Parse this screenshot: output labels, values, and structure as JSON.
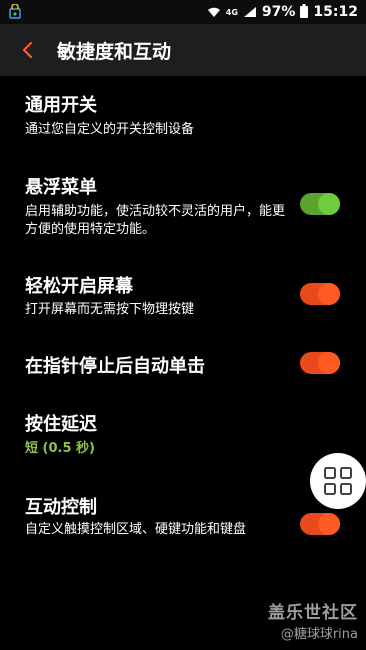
{
  "status_bar": {
    "network_type": "4G",
    "battery": "97%",
    "time": "15:12"
  },
  "app_bar": {
    "title": "敏捷度和互动"
  },
  "items": [
    {
      "title": "通用开关",
      "subtitle": "通过您自定义的开关控制设备"
    },
    {
      "title": "悬浮菜单",
      "subtitle": "启用辅助功能，使活动较不灵活的用户，能更方便的使用特定功能。",
      "toggle_on": true,
      "toggle_color": "#6dbf3a"
    },
    {
      "title": "轻松开启屏幕",
      "subtitle": "打开屏幕而无需按下物理按键",
      "toggle_on": true,
      "toggle_color": "#ff5722"
    },
    {
      "title": "在指针停止后自动单击",
      "toggle_on": true,
      "toggle_color": "#ff5722"
    },
    {
      "title": "按住延迟",
      "subtitle": "短 (0.5 秒)"
    },
    {
      "title": "互动控制",
      "subtitle": "自定义触摸控制区域、硬键功能和键盘",
      "toggle_on": true,
      "toggle_color": "#ff5722"
    }
  ],
  "watermark": {
    "main": "盖乐世社区",
    "sub": "@糖球球rina"
  }
}
